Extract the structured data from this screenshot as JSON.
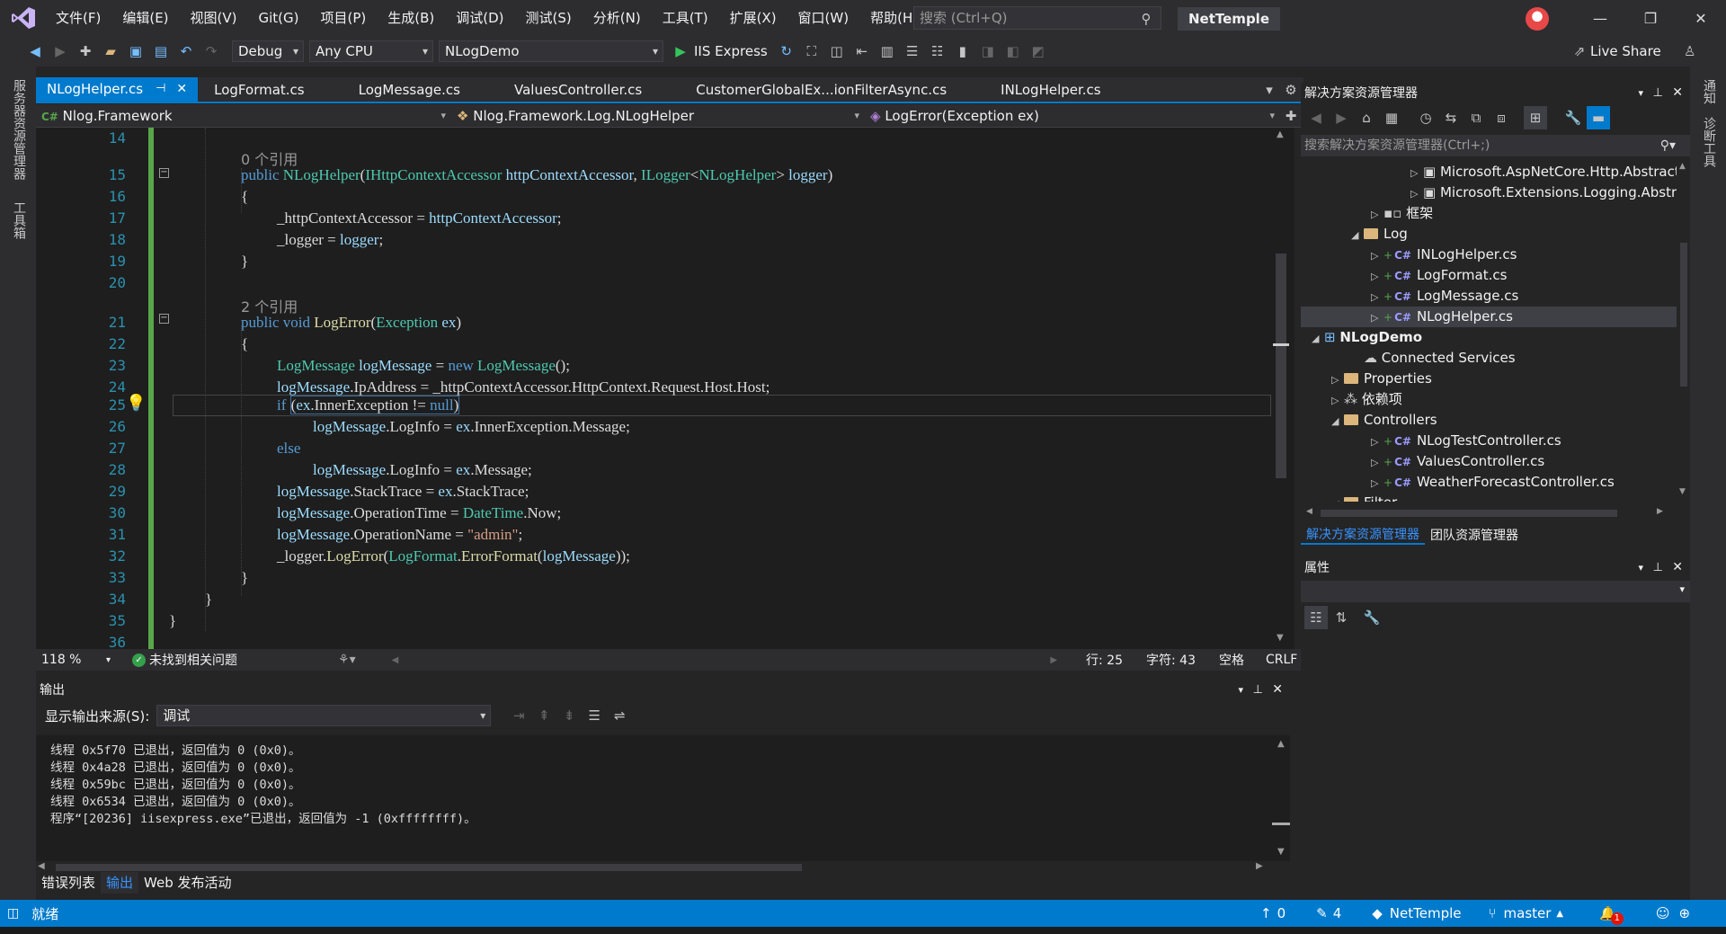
{
  "menu": [
    "文件(F)",
    "编辑(E)",
    "视图(V)",
    "Git(G)",
    "项目(P)",
    "生成(B)",
    "调试(D)",
    "测试(S)",
    "分析(N)",
    "工具(T)",
    "扩展(X)",
    "窗口(W)",
    "帮助(H)"
  ],
  "search": {
    "placeholder": "搜索 (Ctrl+Q)"
  },
  "solution_name": "NetTemple",
  "toolbar": {
    "config": "Debug",
    "platform": "Any CPU",
    "project": "NLogDemo",
    "run": "IIS Express",
    "live_share": "Live Share"
  },
  "left_strip": [
    "服务器资源管理器",
    "工具箱"
  ],
  "right_strip": [
    "通知",
    "诊断工具"
  ],
  "tabs": [
    {
      "label": "NLogHelper.cs",
      "active": true
    },
    {
      "label": "LogFormat.cs"
    },
    {
      "label": "LogMessage.cs"
    },
    {
      "label": "ValuesController.cs"
    },
    {
      "label": "CustomerGlobalEx...ionFilterAsync.cs"
    },
    {
      "label": "INLogHelper.cs"
    }
  ],
  "nav": {
    "project": "Nlog.Framework",
    "class": "Nlog.Framework.Log.NLogHelper",
    "member": "LogError(Exception ex)"
  },
  "code": {
    "ref0": "0 个引用",
    "ref2": "2 个引用",
    "line_numbers": [
      "14",
      "15",
      "16",
      "17",
      "18",
      "19",
      "20",
      "21",
      "22",
      "23",
      "24",
      "25",
      "26",
      "27",
      "28",
      "29",
      "30",
      "31",
      "32",
      "33",
      "34",
      "35",
      "36"
    ]
  },
  "editor_status": {
    "zoom": "118 %",
    "issues": "未找到相关问题",
    "line": "行: 25",
    "char": "字符: 43",
    "space": "空格",
    "eol": "CRLF"
  },
  "output": {
    "title": "输出",
    "source_label": "显示输出来源(S):",
    "source_value": "调试",
    "lines": [
      "线程 0x5f70 已退出，返回值为 0 (0x0)。",
      "线程 0x4a28 已退出，返回值为 0 (0x0)。",
      "线程 0x59bc 已退出，返回值为 0 (0x0)。",
      "线程 0x6534 已退出，返回值为 0 (0x0)。",
      "程序“[20236] iisexpress.exe”已退出，返回值为 -1 (0xffffffff)。"
    ]
  },
  "bottom_tabs": [
    "错误列表",
    "输出",
    "Web 发布活动"
  ],
  "solution_explorer": {
    "title": "解决方案资源管理器",
    "search_placeholder": "搜索解决方案资源管理器(Ctrl+;)",
    "items": [
      {
        "label": "Microsoft.AspNetCore.Http.Abstractio",
        "indent": 5,
        "kind": "pkg",
        "arrow": "▷"
      },
      {
        "label": "Microsoft.Extensions.Logging.Abstract",
        "indent": 5,
        "kind": "pkg",
        "arrow": "▷"
      },
      {
        "label": "框架",
        "indent": 3,
        "kind": "ref",
        "arrow": "▷"
      },
      {
        "label": "Log",
        "indent": 2,
        "kind": "folder",
        "arrow": "◢"
      },
      {
        "label": "INLogHelper.cs",
        "indent": 3,
        "kind": "cs",
        "arrow": "▷"
      },
      {
        "label": "LogFormat.cs",
        "indent": 3,
        "kind": "cs",
        "arrow": "▷"
      },
      {
        "label": "LogMessage.cs",
        "indent": 3,
        "kind": "cs",
        "arrow": "▷"
      },
      {
        "label": "NLogHelper.cs",
        "indent": 3,
        "kind": "cs",
        "arrow": "▷",
        "selected": true
      },
      {
        "label": "NLogDemo",
        "indent": 0,
        "kind": "proj",
        "arrow": "◢",
        "bold": true
      },
      {
        "label": "Connected Services",
        "indent": 2,
        "kind": "svc",
        "arrow": ""
      },
      {
        "label": "Properties",
        "indent": 1,
        "kind": "folder",
        "arrow": "▷"
      },
      {
        "label": "依赖项",
        "indent": 1,
        "kind": "dep",
        "arrow": "▷"
      },
      {
        "label": "Controllers",
        "indent": 1,
        "kind": "folder",
        "arrow": "◢"
      },
      {
        "label": "NLogTestController.cs",
        "indent": 3,
        "kind": "cs",
        "arrow": "▷"
      },
      {
        "label": "ValuesController.cs",
        "indent": 3,
        "kind": "cs",
        "arrow": "▷"
      },
      {
        "label": "WeatherForecastController.cs",
        "indent": 3,
        "kind": "cs",
        "arrow": "▷"
      },
      {
        "label": "Filter",
        "indent": 1,
        "kind": "folder",
        "arrow": "◢"
      }
    ],
    "tabs": [
      "解决方案资源管理器",
      "团队资源管理器"
    ]
  },
  "properties": {
    "title": "属性"
  },
  "status": {
    "ready": "就绪",
    "up": "0",
    "edits": "4",
    "repo": "NetTemple",
    "branch": "master",
    "notif": "1"
  },
  "colors": {
    "accent": "#007acc",
    "bg": "#1e1e1e",
    "chrome": "#2d2d30"
  }
}
